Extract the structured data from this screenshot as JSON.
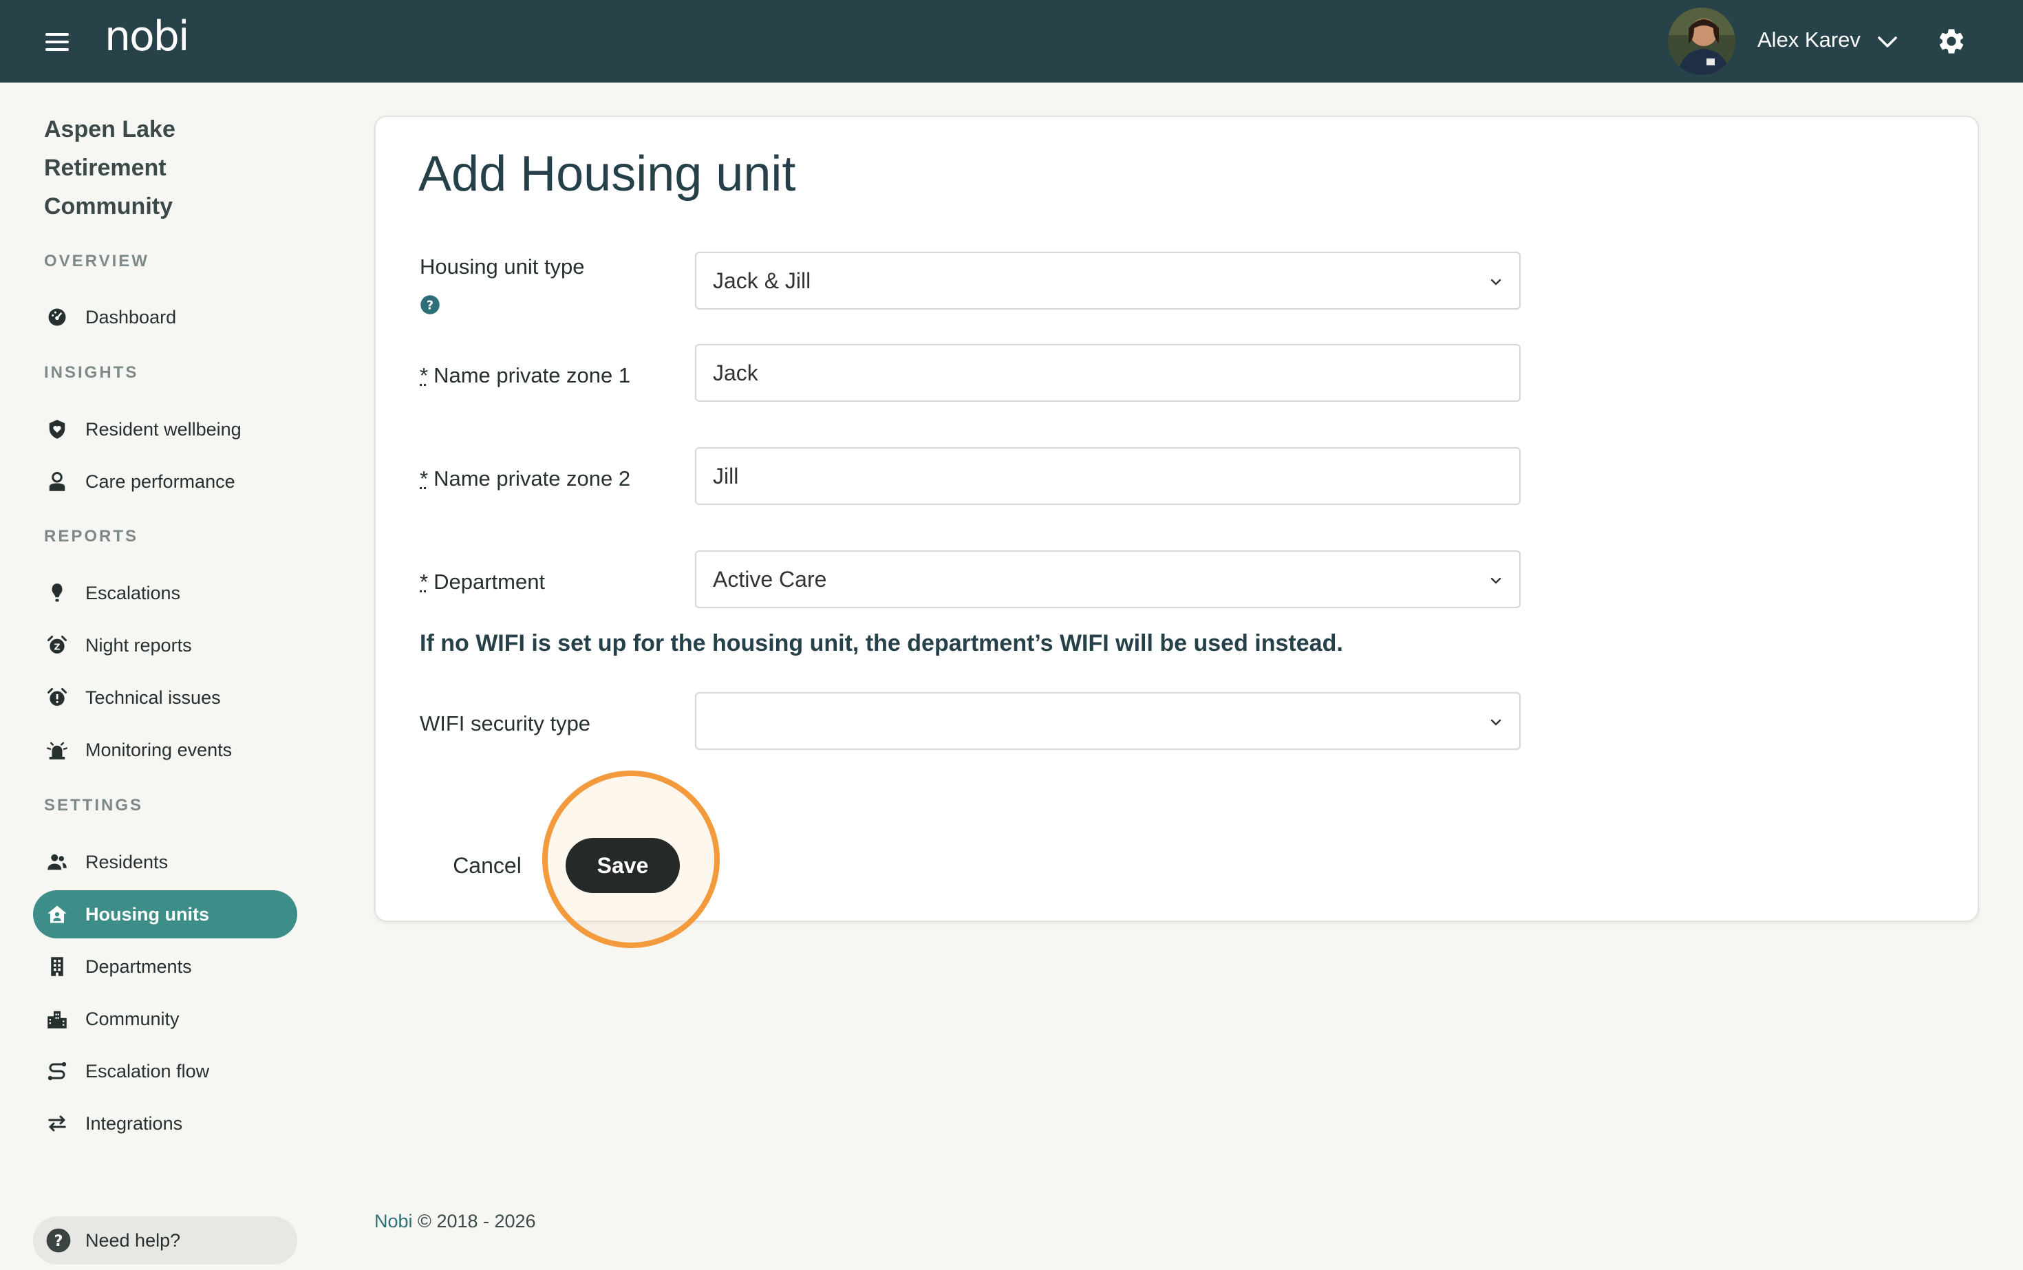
{
  "topbar": {
    "logo": "nobi",
    "user_name": "Alex Karev",
    "colors": {
      "background": "#274349"
    }
  },
  "sidebar": {
    "org_name": "Aspen Lake Retirement Community",
    "sections": {
      "overview": "OVERVIEW",
      "insights": "INSIGHTS",
      "reports": "REPORTS",
      "settings": "SETTINGS"
    },
    "items": [
      {
        "label": "Dashboard",
        "icon": "dashboard-icon"
      },
      {
        "label": "Resident wellbeing",
        "icon": "shield-heart-icon"
      },
      {
        "label": "Care performance",
        "icon": "caregiver-icon"
      },
      {
        "label": "Escalations",
        "icon": "alert-icon"
      },
      {
        "label": "Night reports",
        "icon": "alarm-clock-icon"
      },
      {
        "label": "Technical issues",
        "icon": "alarm-warning-icon"
      },
      {
        "label": "Monitoring events",
        "icon": "siren-icon"
      },
      {
        "label": "Residents",
        "icon": "people-icon"
      },
      {
        "label": "Housing units",
        "icon": "house-person-icon",
        "active": true
      },
      {
        "label": "Departments",
        "icon": "building-icon"
      },
      {
        "label": "Community",
        "icon": "city-icon"
      },
      {
        "label": "Escalation flow",
        "icon": "flow-icon"
      },
      {
        "label": "Integrations",
        "icon": "arrows-exchange-icon"
      }
    ],
    "help_label": "Need help?",
    "colors": {
      "active": "#3d8e88"
    }
  },
  "form": {
    "title": "Add Housing unit",
    "housing_unit_type": {
      "label": "Housing unit type",
      "value": "Jack & Jill"
    },
    "zone1": {
      "required_mark": "*",
      "label": "Name private zone 1",
      "value": "Jack"
    },
    "zone2": {
      "required_mark": "*",
      "label": "Name private zone 2",
      "value": "Jill"
    },
    "department": {
      "required_mark": "*",
      "label": "Department",
      "value": "Active Care"
    },
    "wifi_note": "If no WIFI is set up for the housing unit, the department’s WIFI will be used instead.",
    "wifi_security": {
      "label": "WIFI security type",
      "value": ""
    },
    "cancel_label": "Cancel",
    "save_label": "Save",
    "colors": {
      "save_bg": "#252a28",
      "highlight": "#f39a3c"
    }
  },
  "footer": {
    "brand": "Nobi",
    "copyright": "© 2018 - 2026"
  }
}
